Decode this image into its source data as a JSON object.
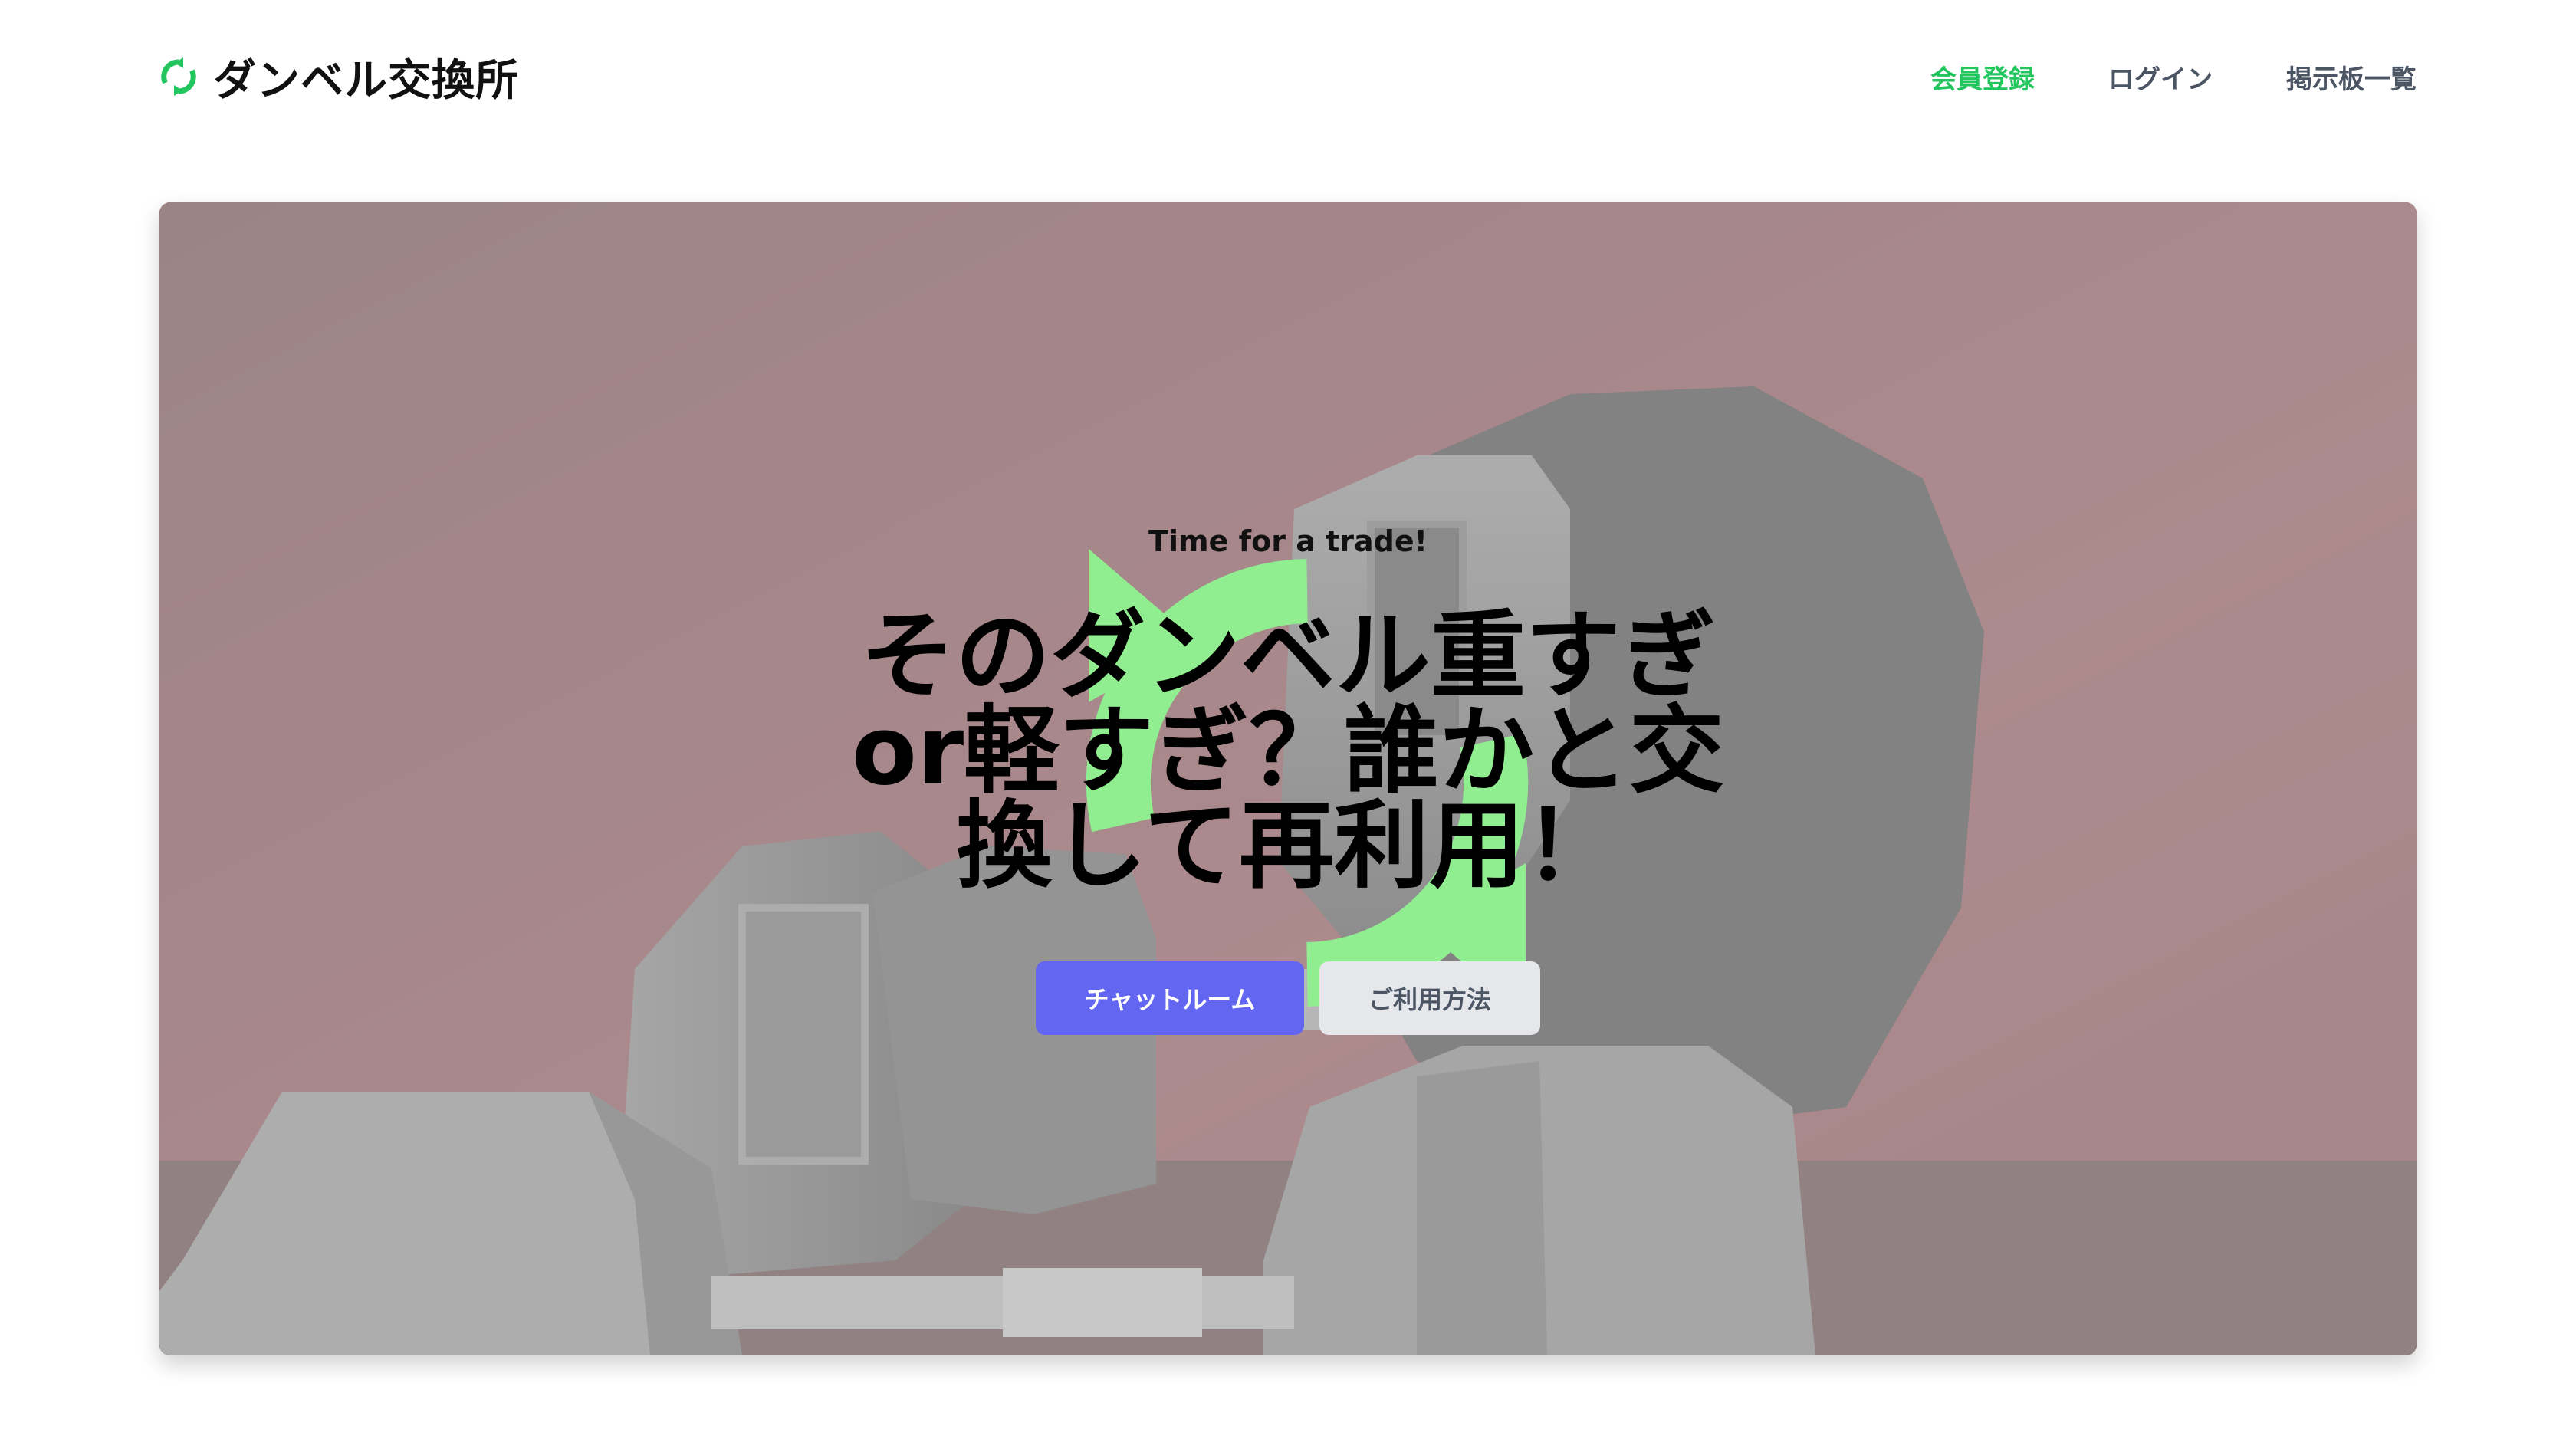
{
  "header": {
    "brand": "ダンベル交換所",
    "nav": [
      {
        "label": "会員登録",
        "accent": true
      },
      {
        "label": "ログイン",
        "accent": false
      },
      {
        "label": "掲示板一覧",
        "accent": false
      }
    ]
  },
  "hero": {
    "tagline": "Time for a trade!",
    "heading": "そのダンベル重すぎor軽すぎ？誰かと交換して再利用！",
    "primary_button": "チャットルーム",
    "secondary_button": "ご利用方法",
    "background_image": "dumbbells-photo",
    "logo_icon": "recycle-arrows-icon"
  },
  "colors": {
    "accent_green": "#22c55e",
    "logo_green": "#90ee90",
    "primary_button": "#6366f1",
    "secondary_button": "#e5e7eb",
    "nav_text": "#4b5563"
  }
}
